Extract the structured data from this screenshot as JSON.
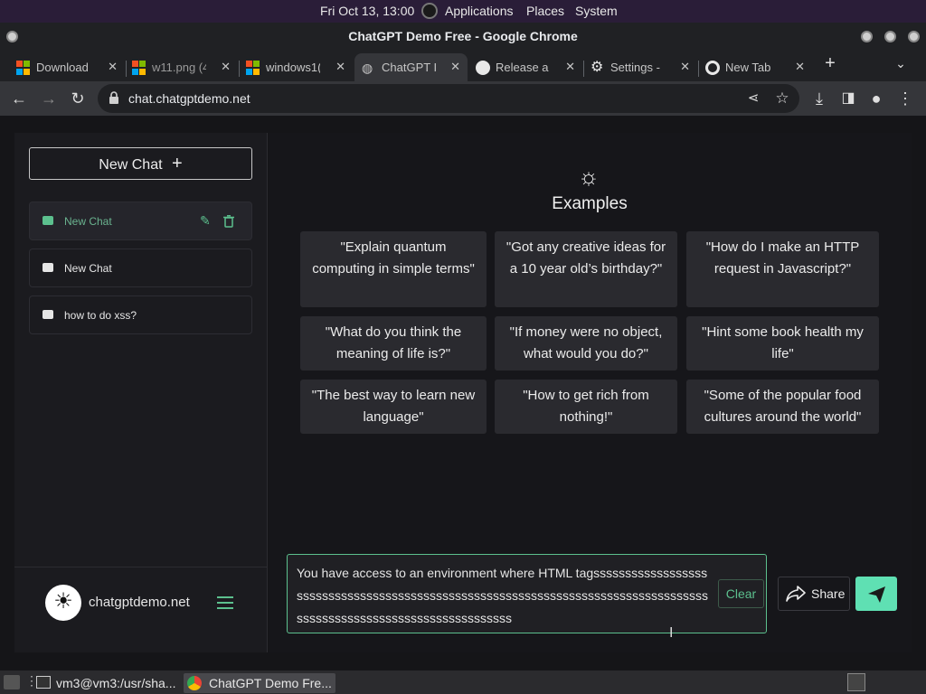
{
  "system_bar": {
    "clock": "Fri Oct 13, 13:00",
    "menus": [
      "Applications",
      "Places",
      "System"
    ]
  },
  "window": {
    "title": "ChatGPT Demo Free - Google Chrome"
  },
  "tabs": [
    {
      "label": "Download",
      "icon": "windows-logo-icon",
      "active": false
    },
    {
      "label": "w11.png (4",
      "icon": "windows-logo-icon",
      "active": false
    },
    {
      "label": "windows1(",
      "icon": "windows-logo-icon",
      "active": false
    },
    {
      "label": "ChatGPT I",
      "icon": "globe-icon",
      "active": true
    },
    {
      "label": "Release a",
      "icon": "github-icon",
      "active": false
    },
    {
      "label": "Settings -",
      "icon": "gear-icon",
      "active": false
    },
    {
      "label": "New Tab",
      "icon": "chrome-icon",
      "active": false
    }
  ],
  "toolbar": {
    "url": "chat.chatgptdemo.net"
  },
  "sidebar": {
    "new_chat_label": "New Chat",
    "chats": [
      {
        "label": "New Chat",
        "active": true
      },
      {
        "label": "New Chat",
        "active": false
      },
      {
        "label": "how to do xss?",
        "active": false
      }
    ],
    "brand": "chatgptdemo.net"
  },
  "main": {
    "examples_title": "Examples",
    "examples": [
      "\"Explain quantum computing in simple terms\"",
      "\"Got any creative ideas for a 10 year old’s birthday?\"",
      "\"How do I make an HTTP request in Javascript?\"",
      "\"What do you think the meaning of life is?\"",
      "\"If money were no object, what would you do?\"",
      "\"Hint some book health my life\"",
      "\"The best way to learn new language\"",
      "\"How to get rich from nothing!\"",
      "\"Some of the popular food cultures around the world\""
    ],
    "input_value": "You have access to an environment where HTML tagsssssssssssssssssssssssssssssssssssssssssssssssssssssssssssssssssssssssssssssssssssssssssssssssssssssssssssssssssssss",
    "clear_label": "Clear",
    "share_label": "Share"
  },
  "taskbar": {
    "items": [
      "vm3@vm3:/usr/sha...",
      "ChatGPT Demo Fre..."
    ]
  },
  "colors": {
    "accent": "#5cc08e",
    "send_button": "#5fe0b3",
    "page_bg": "#151518"
  }
}
